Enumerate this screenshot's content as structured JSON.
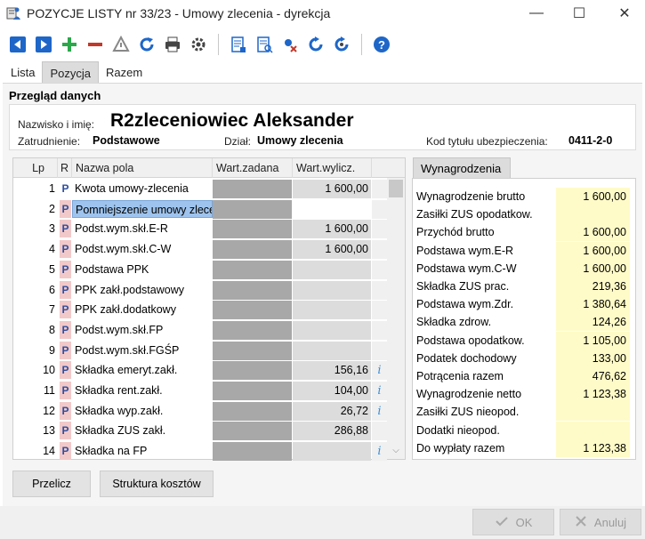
{
  "window": {
    "title": "POZYCJE LISTY nr 33/23 - Umowy zlecenia - dyrekcja",
    "minimize": "—",
    "maximize": "☐",
    "close": "✕"
  },
  "toolbar": {
    "icons": [
      "prev-icon",
      "next-icon",
      "add-icon",
      "remove-icon",
      "warning-icon",
      "refresh-icon",
      "print-icon",
      "settings-icon",
      "report-icon",
      "report-search-icon",
      "tools-icon",
      "cycle-icon",
      "cycle-user-icon",
      "help-icon"
    ]
  },
  "tabs": [
    "Lista",
    "Pozycja",
    "Razem"
  ],
  "section_title": "Przegląd danych",
  "employee": {
    "name_label": "Nazwisko i imię:",
    "name": "R2zleceniowiec Aleksander",
    "employment_label": "Zatrudnienie:",
    "employment": "Podstawowe",
    "department_label": "Dział:",
    "department": "Umowy zlecenia",
    "insurance_label": "Kod tytułu ubezpieczenia:",
    "insurance_code": "0411-2-0"
  },
  "grid": {
    "headers": [
      "Lp",
      "R",
      "Nazwa pola",
      "Wart.zadana",
      "Wart.wylicz."
    ],
    "rows": [
      {
        "lp": "1",
        "r": "P",
        "name": "Kwota umowy-zlecenia",
        "wylicz": "1 600,00",
        "info": ""
      },
      {
        "lp": "2",
        "r": "P",
        "name": "Pomniejszenie umowy zlecenia",
        "wylicz": "",
        "info": ""
      },
      {
        "lp": "3",
        "r": "P",
        "name": "Podst.wym.skł.E-R",
        "wylicz": "1 600,00",
        "info": ""
      },
      {
        "lp": "4",
        "r": "P",
        "name": "Podst.wym.skł.C-W",
        "wylicz": "1 600,00",
        "info": ""
      },
      {
        "lp": "5",
        "r": "P",
        "name": "Podstawa PPK",
        "wylicz": "",
        "info": ""
      },
      {
        "lp": "6",
        "r": "P",
        "name": "PPK zakł.podstawowy",
        "wylicz": "",
        "info": ""
      },
      {
        "lp": "7",
        "r": "P",
        "name": "PPK zakł.dodatkowy",
        "wylicz": "",
        "info": ""
      },
      {
        "lp": "8",
        "r": "P",
        "name": "Podst.wym.skł.FP",
        "wylicz": "",
        "info": ""
      },
      {
        "lp": "9",
        "r": "P",
        "name": "Podst.wym.skł.FGŚP",
        "wylicz": "",
        "info": ""
      },
      {
        "lp": "10",
        "r": "P",
        "name": "Składka emeryt.zakł.",
        "wylicz": "156,16",
        "info": "i"
      },
      {
        "lp": "11",
        "r": "P",
        "name": "Składka rent.zakł.",
        "wylicz": "104,00",
        "info": "i"
      },
      {
        "lp": "12",
        "r": "P",
        "name": "Składka wyp.zakł.",
        "wylicz": "26,72",
        "info": "i"
      },
      {
        "lp": "13",
        "r": "P",
        "name": "Składka ZUS zakł.",
        "wylicz": "286,88",
        "info": ""
      },
      {
        "lp": "14",
        "r": "P",
        "name": "Składka na FP",
        "wylicz": "",
        "info": "i"
      }
    ]
  },
  "salary": {
    "tab": "Wynagrodzenia",
    "rows": [
      {
        "label": "Wynagrodzenie brutto",
        "value": "1 600,00"
      },
      {
        "label": "Zasiłki ZUS opodatkow.",
        "value": ""
      },
      {
        "label": "Przychód brutto",
        "value": "1 600,00"
      },
      {
        "label": "Podstawa wym.E-R",
        "value": "1 600,00"
      },
      {
        "label": "Podstawa wym.C-W",
        "value": "1 600,00"
      },
      {
        "label": "Składka ZUS prac.",
        "value": "219,36"
      },
      {
        "label": "Podstawa wym.Zdr.",
        "value": "1 380,64"
      },
      {
        "label": "Składka zdrow.",
        "value": "124,26"
      },
      {
        "label": "Podstawa opodatkow.",
        "value": "1 105,00"
      },
      {
        "label": "Podatek dochodowy",
        "value": "133,00"
      },
      {
        "label": "Potrącenia razem",
        "value": "476,62"
      },
      {
        "label": "Wynagrodzenie netto",
        "value": "1 123,38"
      },
      {
        "label": "Zasiłki ZUS nieopod.",
        "value": ""
      },
      {
        "label": "Dodatki nieopod.",
        "value": ""
      },
      {
        "label": "Do wypłaty razem",
        "value": "1 123,38"
      }
    ]
  },
  "buttons": {
    "przelicz": "Przelicz",
    "struktura": "Struktura kosztów",
    "ok": "OK",
    "anuluj": "Anuluj"
  },
  "colors": {
    "accent_blue": "#1e66c8",
    "add_green": "#2aa84a",
    "remove_red": "#c0392b",
    "selection": "#9ec4ee",
    "value_yellow": "#fffbc8",
    "r_pink": "#f2c9c9"
  }
}
